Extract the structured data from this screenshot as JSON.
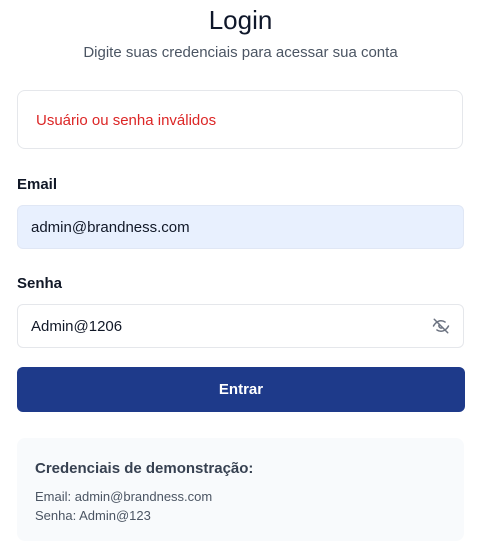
{
  "header": {
    "title": "Login",
    "subtitle": "Digite suas credenciais para acessar sua conta"
  },
  "error": {
    "message": "Usuário ou senha inválidos",
    "color": "#dc2626"
  },
  "form": {
    "email_label": "Email",
    "email_value": "admin@brandness.com",
    "password_label": "Senha",
    "password_value": "Admin@1206",
    "password_toggle_icon": "eye-off-icon",
    "submit_label": "Entrar"
  },
  "demo": {
    "title": "Credenciais de demonstração:",
    "email_line": "Email: admin@brandness.com",
    "password_line": "Senha: Admin@123"
  },
  "colors": {
    "primary": "#1e3a8a",
    "autofill_bg": "#e8f0fe",
    "demo_bg": "#f8fafc"
  }
}
